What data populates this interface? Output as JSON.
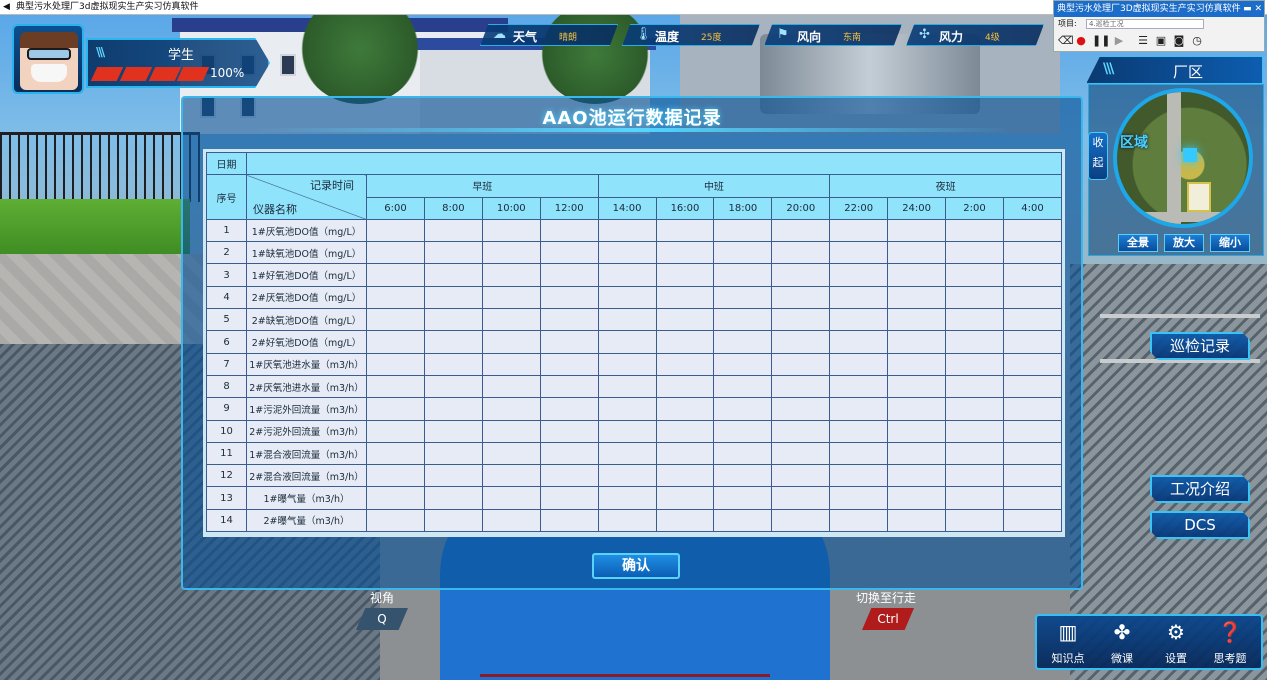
{
  "window": {
    "title": "典型污水处理厂3d虚拟现实生产实习仿真软件"
  },
  "recorder": {
    "title": "典型污水处理厂3D虚拟现实生产实习仿真软件",
    "project_label": "项目:",
    "project_value": "4.巡检工况"
  },
  "student": {
    "name": "学生",
    "health": "100%"
  },
  "status": [
    {
      "label": "天气",
      "value": "晴朗",
      "icon": "weather-icon"
    },
    {
      "label": "温度",
      "value": "25度",
      "icon": "thermometer-icon"
    },
    {
      "label": "风向",
      "value": "东南",
      "icon": "flag-icon"
    },
    {
      "label": "风力",
      "value": "4级",
      "icon": "wind-icon"
    }
  ],
  "map": {
    "title": "厂区",
    "collapse": "收起",
    "area_label": "区域",
    "buttons": [
      "全景",
      "放大",
      "缩小"
    ]
  },
  "side_buttons": {
    "inspection": "巡检记录",
    "intro": "工况介绍",
    "dcs": "DCS"
  },
  "toolbar": [
    "知识点",
    "微课",
    "设置",
    "思考题"
  ],
  "hints": {
    "view_label": "视角",
    "view_key": "Q",
    "walk_label": "切换至行走",
    "walk_key": "Ctrl"
  },
  "dialog": {
    "title": "AAO池运行数据记录",
    "date_label": "日期",
    "seq_label": "序号",
    "time_label": "记录时间",
    "instrument_label": "仪器名称",
    "shifts": [
      "早班",
      "中班",
      "夜班"
    ],
    "times": [
      "6:00",
      "8:00",
      "10:00",
      "12:00",
      "14:00",
      "16:00",
      "18:00",
      "20:00",
      "22:00",
      "24:00",
      "2:00",
      "4:00"
    ],
    "rows": [
      {
        "no": "1",
        "name": "1#厌氧池DO值（mg/L）"
      },
      {
        "no": "2",
        "name": "1#缺氧池DO值（mg/L）"
      },
      {
        "no": "3",
        "name": "1#好氧池DO值（mg/L）"
      },
      {
        "no": "4",
        "name": "2#厌氧池DO值（mg/L）"
      },
      {
        "no": "5",
        "name": "2#缺氧池DO值（mg/L）"
      },
      {
        "no": "6",
        "name": "2#好氧池DO值（mg/L）"
      },
      {
        "no": "7",
        "name": "1#厌氧池进水量（m3/h）"
      },
      {
        "no": "8",
        "name": "2#厌氧池进水量（m3/h）"
      },
      {
        "no": "9",
        "name": "1#污泥外回流量（m3/h）"
      },
      {
        "no": "10",
        "name": "2#污泥外回流量（m3/h）"
      },
      {
        "no": "11",
        "name": "1#混合液回流量（m3/h）"
      },
      {
        "no": "12",
        "name": "2#混合液回流量（m3/h）"
      },
      {
        "no": "13",
        "name": "1#曝气量（m3/h）"
      },
      {
        "no": "14",
        "name": "2#曝气量（m3/h）"
      }
    ],
    "confirm": "确认"
  }
}
